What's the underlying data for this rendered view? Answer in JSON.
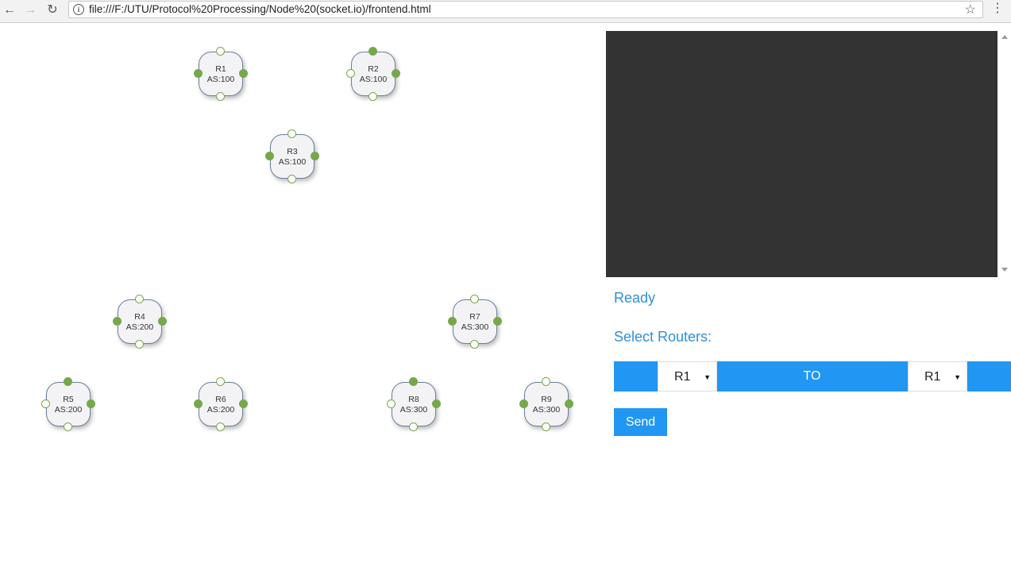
{
  "browser": {
    "back_icon": "arrow-left-icon",
    "forward_icon": "arrow-right-icon",
    "reload_icon": "reload-icon",
    "info_icon": "info-icon",
    "url": "file:///F:/UTU/Protocol%20Processing/Node%20(socket.io)/frontend.html",
    "bookmark_icon": "star-icon",
    "menu_icon": "kebab-menu-icon"
  },
  "routers": [
    {
      "name": "R1",
      "as": "AS:100"
    },
    {
      "name": "R2",
      "as": "AS:100"
    },
    {
      "name": "R3",
      "as": "AS:100"
    },
    {
      "name": "R4",
      "as": "AS:200"
    },
    {
      "name": "R5",
      "as": "AS:200"
    },
    {
      "name": "R6",
      "as": "AS:200"
    },
    {
      "name": "R7",
      "as": "AS:300"
    },
    {
      "name": "R8",
      "as": "AS:300"
    },
    {
      "name": "R9",
      "as": "AS:300"
    }
  ],
  "panel": {
    "status": "Ready",
    "select_label": "Select Routers:",
    "from_router": "R1",
    "to_label": "TO",
    "to_router": "R1",
    "send_label": "Send"
  },
  "colors": {
    "accent": "#2196f3",
    "text_accent": "#2e8fdd",
    "console_bg": "#333333",
    "endpoint_green": "#76a84a"
  }
}
